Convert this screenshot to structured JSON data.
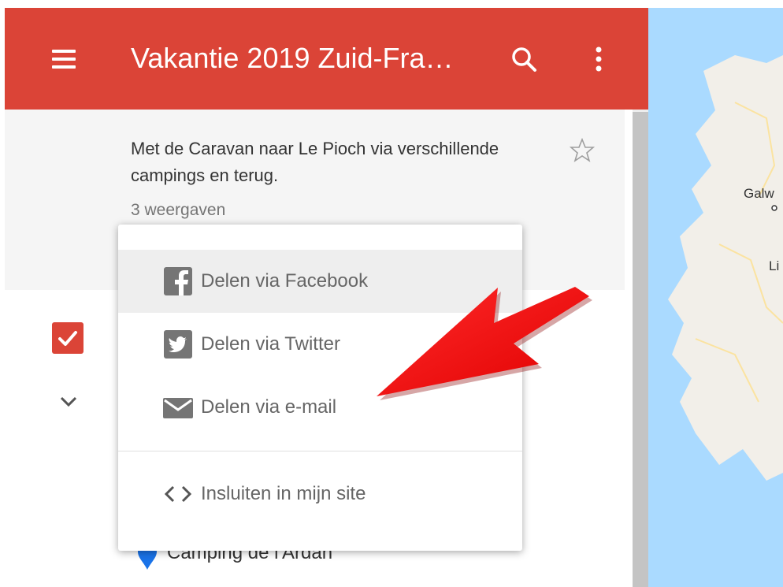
{
  "app_bar": {
    "title": "Vakantie 2019 Zuid-Fra…"
  },
  "map_info": {
    "description": "Met de Caravan naar Le Pioch via verschillende campings en terug.",
    "views": "3 weergaven"
  },
  "share_menu": {
    "items": [
      {
        "label": "Delen via Facebook",
        "icon": "facebook-icon"
      },
      {
        "label": "Delen via Twitter",
        "icon": "twitter-icon"
      },
      {
        "label": "Delen via e-mail",
        "icon": "mail-icon"
      },
      {
        "label": "Insluiten in mijn site",
        "icon": "embed-code-icon"
      }
    ]
  },
  "layers": {
    "items": [
      {
        "label": "Camping de l'Ardan"
      }
    ]
  },
  "map": {
    "labels": [
      "Galw",
      "Li"
    ]
  },
  "colors": {
    "app_bar": "#db4437",
    "checkbox": "#db4437",
    "map_water": "#aadaff",
    "pin": "#1a73e8",
    "annotation_arrow": "#ff0000"
  }
}
